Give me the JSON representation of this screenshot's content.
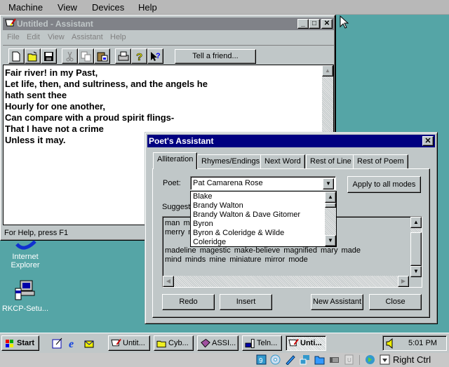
{
  "host_menu": [
    "Machine",
    "View",
    "Devices",
    "Help"
  ],
  "main_window": {
    "title": "Untitled - Assistant",
    "controls": {
      "minimize": "_",
      "maximize": "□",
      "close": "✕"
    },
    "menu": [
      "File",
      "Edit",
      "View",
      "Assistant",
      "Help"
    ],
    "toolbar": {
      "icons": [
        "new-icon",
        "open-icon",
        "save-icon",
        "cut-icon",
        "copy-icon",
        "paste-icon",
        "print-icon",
        "help-icon",
        "context-help-icon"
      ],
      "tell_friend_label": "Tell a friend..."
    },
    "poem_lines": [
      "Fair river! in my Past,",
      "Let life, then, and sultriness, and the angels he",
      "hath sent thee",
      "Hourly for one another,",
      "Can compare with a proud spirit flings-",
      "That I have not a crime",
      "Unless it may."
    ],
    "status": "For Help, press F1"
  },
  "desktop_icons": [
    {
      "label_line1": "Internet",
      "label_line2": "Explorer",
      "icon": "internet-explorer-icon"
    },
    {
      "label_line1": "RKCP-Setu...",
      "label_line2": "",
      "icon": "setup-computer-icon"
    }
  ],
  "dialog": {
    "title": "Poet's Assistant",
    "close": "✕",
    "tabs": [
      "Alliteration",
      "Rhymes/Endings",
      "Next Word",
      "Rest of Line",
      "Rest of Poem"
    ],
    "active_tab": "Alliteration",
    "poet_label": "Poet:",
    "poet_selected": "Pat Camarena Rose",
    "poet_options": [
      "Blake",
      "Brandy Walton",
      "Brandy Walton & Dave Gitomer",
      "Byron",
      "Byron & Coleridge & Wilde",
      "Coleridge"
    ],
    "apply_all_label": "Apply to all modes",
    "suggestions_label": "Suggest",
    "suggestion_lines": [
      "man  ma",
      "merry  m",
      "",
      "madeline  magestic  make-believe  magnified  mary  made",
      "mind  minds  mine  miniature  mirror  mode"
    ],
    "buttons": {
      "redo": "Redo",
      "insert": "Insert",
      "new_assistant": "New Assistant",
      "close": "Close"
    }
  },
  "taskbar": {
    "start_label": "Start",
    "quick_launch": [
      "show-desktop-icon",
      "internet-explorer-icon",
      "outlook-express-icon"
    ],
    "tasks": [
      "Untit...",
      "Cyb...",
      "ASSI...",
      "Teln...",
      "Unti..."
    ],
    "active_task_index": 4,
    "clock": "5:01 PM"
  },
  "vbox_status": {
    "icons": [
      "hard-disk-icon",
      "optical-drive-icon",
      "usb-icon",
      "network-icon",
      "shared-folder-icon",
      "video-capture-icon",
      "cpu-icon",
      "mouse-integration-icon",
      "keyboard-capture-icon"
    ],
    "host_key": "Right Ctrl"
  }
}
